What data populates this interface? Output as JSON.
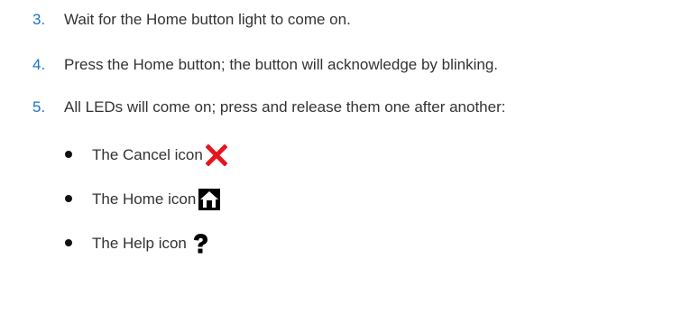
{
  "steps": [
    {
      "number": "3.",
      "text": "Wait for the Home button light to come on."
    },
    {
      "number": "4.",
      "text": "Press the Home button; the button will acknowledge by blinking."
    },
    {
      "number": "5.",
      "text": "All LEDs will come on; press and release them one after another:"
    }
  ],
  "bullets": [
    {
      "text": "The Cancel icon",
      "icon": "cancel-icon"
    },
    {
      "text": "The Home icon",
      "icon": "home-icon"
    },
    {
      "text": "The Help icon",
      "icon": "help-icon"
    }
  ],
  "colors": {
    "step_number": "#1a73c8",
    "body_text": "#333333",
    "cancel_icon": "#e8141c",
    "home_icon_bg": "#000000",
    "help_icon": "#000000"
  }
}
